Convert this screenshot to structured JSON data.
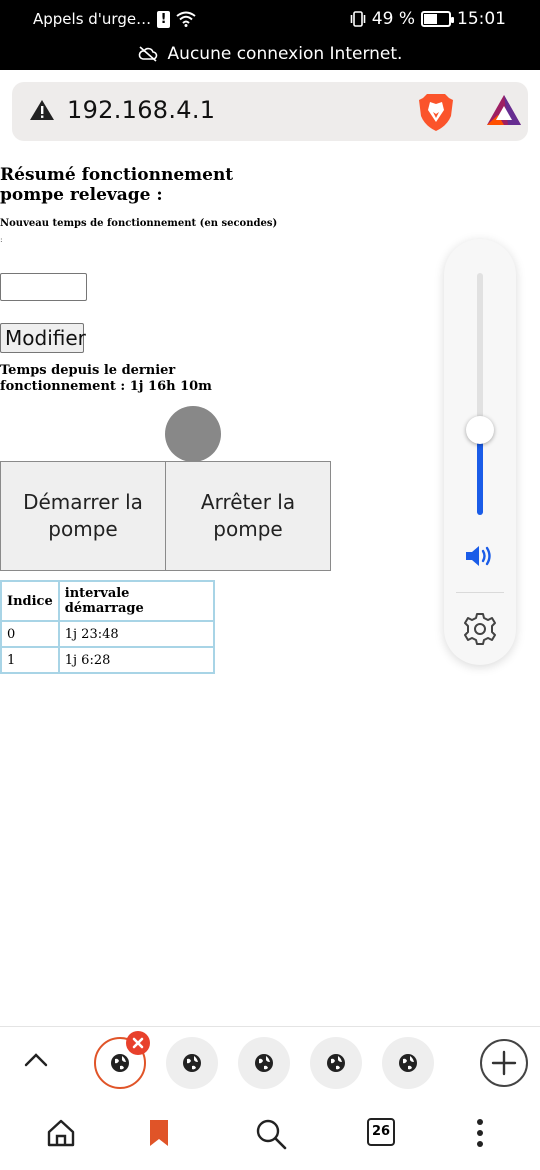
{
  "status_bar": {
    "carrier_text": "Appels d'urge…",
    "battery_percent": "49 %",
    "battery_level": 0.49,
    "time": "15:01"
  },
  "offline_banner": {
    "text": "Aucune connexion Internet."
  },
  "address_bar": {
    "url": "192.168.4.1",
    "brand_colors": {
      "brave": "#fb542b",
      "bat": "#662d91"
    }
  },
  "page": {
    "title": "Résumé fonctionnement pompe relevage :",
    "runtime_label": "Nouveau temps de fonctionnement (en secondes)",
    "colon": ":",
    "runtime_input_value": "",
    "modify_label": "Modifier",
    "elapsed_text": "Temps depuis le dernier fonctionnement : 1j 16h 10m",
    "status_dot_color": "#888888",
    "start_label": "Démarrer la pompe",
    "stop_label": "Arrêter la pompe",
    "table": {
      "headers": [
        "Indice",
        "intervale démarrage"
      ],
      "rows": [
        [
          "0",
          "1j 23:48"
        ],
        [
          "1",
          "1j 6:28"
        ]
      ]
    }
  },
  "volume": {
    "level": 0.35,
    "accent": "#1a5ce8"
  },
  "tabs": {
    "count": 5,
    "active_index": 0,
    "accent": "#e05428"
  },
  "bottom_nav": {
    "tab_count": "26"
  }
}
